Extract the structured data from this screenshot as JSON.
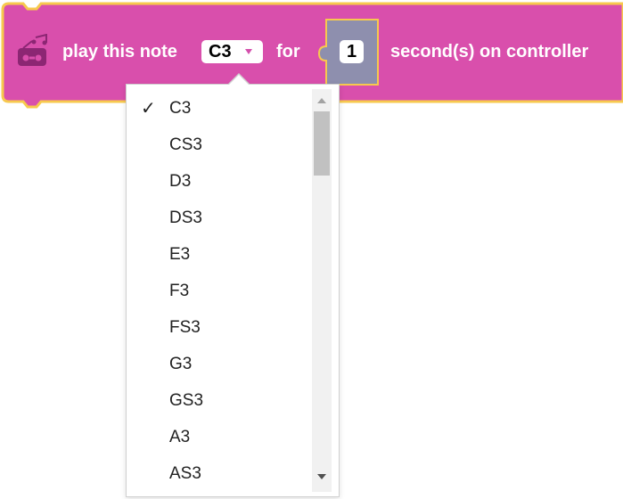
{
  "block": {
    "prefix_label": "play this note",
    "selected_note": "C3",
    "for_label": "for",
    "seconds_value": "1",
    "suffix_label": "second(s) on controller",
    "colors": {
      "block_fill": "#d94fac",
      "block_border": "#f7c94e",
      "input_fill": "#8e8fae",
      "icon_color": "#8c2673"
    },
    "icon": "speaker-icon"
  },
  "dropdown": {
    "items": [
      {
        "label": "C3",
        "check": "✓"
      },
      {
        "label": "CS3",
        "check": ""
      },
      {
        "label": "D3",
        "check": ""
      },
      {
        "label": "DS3",
        "check": ""
      },
      {
        "label": "E3",
        "check": ""
      },
      {
        "label": "F3",
        "check": ""
      },
      {
        "label": "FS3",
        "check": ""
      },
      {
        "label": "G3",
        "check": ""
      },
      {
        "label": "GS3",
        "check": ""
      },
      {
        "label": "A3",
        "check": ""
      },
      {
        "label": "AS3",
        "check": ""
      }
    ],
    "scroll_position_fraction": 0.0
  }
}
